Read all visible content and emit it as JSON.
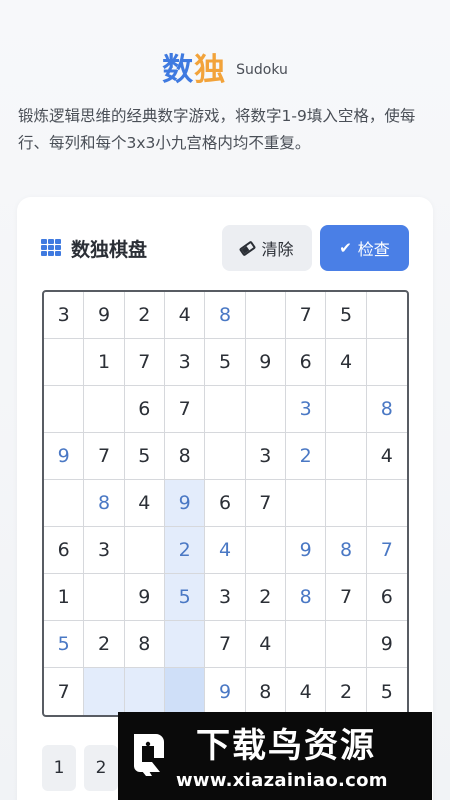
{
  "header": {
    "title_part1": "数",
    "title_part2": "独",
    "subtitle": "Sudoku",
    "description": "锻炼逻辑思维的经典数字游戏，将数字1-9填入空格，使每行、每列和每个3x3小九宫格内均不重复。"
  },
  "board_card": {
    "title": "数独棋盘",
    "clear_label": "清除",
    "check_label": "检查",
    "icons": {
      "board": "grid-icon",
      "clear": "eraser-icon",
      "check": "check-icon"
    },
    "colors": {
      "accent": "#4a7fe6",
      "user_digit": "#4a78c4",
      "highlight": "#e3ecfb",
      "selected": "#cfdff8"
    }
  },
  "grid": [
    [
      "3",
      "9",
      "2",
      "4",
      "8",
      "",
      "7",
      "5",
      ""
    ],
    [
      "",
      "1",
      "7",
      "3",
      "5",
      "9",
      "6",
      "4",
      ""
    ],
    [
      "",
      "",
      "6",
      "7",
      "",
      "",
      "3",
      "",
      "8"
    ],
    [
      "9",
      "7",
      "5",
      "8",
      "",
      "3",
      "2",
      "",
      "4"
    ],
    [
      "",
      "8",
      "4",
      "9",
      "6",
      "7",
      "",
      "",
      ""
    ],
    [
      "6",
      "3",
      "",
      "2",
      "4",
      "",
      "9",
      "8",
      "7"
    ],
    [
      "1",
      "",
      "9",
      "5",
      "3",
      "2",
      "8",
      "7",
      "6"
    ],
    [
      "5",
      "2",
      "8",
      "",
      "7",
      "4",
      "",
      "",
      "9"
    ],
    [
      "7",
      "",
      "",
      "",
      "9",
      "8",
      "4",
      "2",
      "5"
    ]
  ],
  "user_cells": [
    [
      0,
      4
    ],
    [
      2,
      6
    ],
    [
      2,
      8
    ],
    [
      3,
      0
    ],
    [
      3,
      6
    ],
    [
      4,
      1
    ],
    [
      4,
      3
    ],
    [
      5,
      3
    ],
    [
      5,
      4
    ],
    [
      5,
      6
    ],
    [
      5,
      7
    ],
    [
      5,
      8
    ],
    [
      6,
      3
    ],
    [
      6,
      6
    ],
    [
      7,
      0
    ],
    [
      8,
      4
    ]
  ],
  "highlight_cells": [
    [
      4,
      3
    ],
    [
      5,
      3
    ],
    [
      6,
      3
    ],
    [
      7,
      3
    ],
    [
      8,
      1
    ],
    [
      8,
      2
    ],
    [
      8,
      3
    ]
  ],
  "selected_cell": [
    8,
    3
  ],
  "numpad": [
    "1",
    "2"
  ],
  "watermark": {
    "title": "下载鸟资源",
    "url": "www.xiazainiao.com"
  }
}
